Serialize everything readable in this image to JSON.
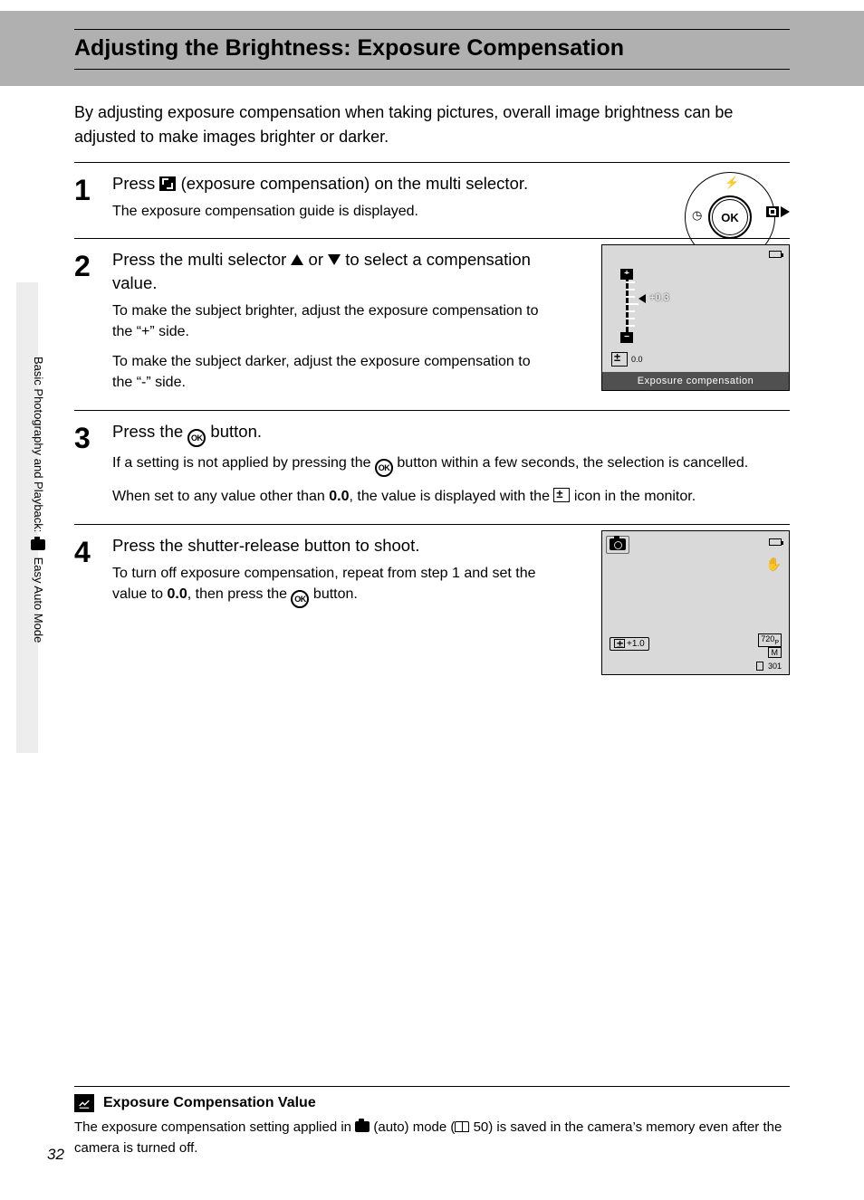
{
  "page": {
    "title": "Adjusting the Brightness: Exposure Compensation",
    "intro": "By adjusting exposure compensation when taking pictures, overall image brightness can be adjusted to make images brighter or darker.",
    "number": "32",
    "side_tab": "Basic Photography and Playback: ",
    "side_tab_suffix": " Easy Auto Mode"
  },
  "steps": {
    "s1": {
      "num": "1",
      "title_a": "Press ",
      "title_b": " (exposure compensation) on the multi selector.",
      "sub1": "The exposure compensation guide is displayed."
    },
    "s2": {
      "num": "2",
      "title_a": "Press the multi selector ",
      "title_mid": " or ",
      "title_b": " to select a compensation value.",
      "sub1": "To make the subject brighter, adjust the exposure compensation to the “+” side.",
      "sub2": "To make the subject darker, adjust the exposure compensation to the “-” side."
    },
    "s3": {
      "num": "3",
      "title_a": "Press the ",
      "title_b": " button.",
      "sub1_a": "If a setting is not applied by pressing the ",
      "sub1_b": " button within a few seconds, the selection is cancelled.",
      "sub2_a": "When set to any value other than ",
      "sub2_bold": "0.0",
      "sub2_b": ", the value is displayed with the ",
      "sub2_c": " icon in the monitor."
    },
    "s4": {
      "num": "4",
      "title": "Press the shutter-release button to shoot.",
      "sub1_a": "To turn off exposure compensation, repeat from step 1 and set the value to ",
      "sub1_bold": "0.0",
      "sub1_b": ", then press the ",
      "sub1_c": " button."
    }
  },
  "lcd1": {
    "value": "+0.3",
    "bottom_val": "0.0",
    "caption": "Exposure compensation"
  },
  "lcd2": {
    "ev": "+1.0",
    "res": "720",
    "res_suffix": "P",
    "size": "M",
    "remaining": "301"
  },
  "ms": {
    "ok": "OK"
  },
  "note": {
    "title": "Exposure Compensation Value",
    "body_a": "The exposure compensation setting applied in ",
    "body_b": " (auto) mode (",
    "body_ref": " 50) is saved in the camera’s memory even after the camera is turned off."
  }
}
